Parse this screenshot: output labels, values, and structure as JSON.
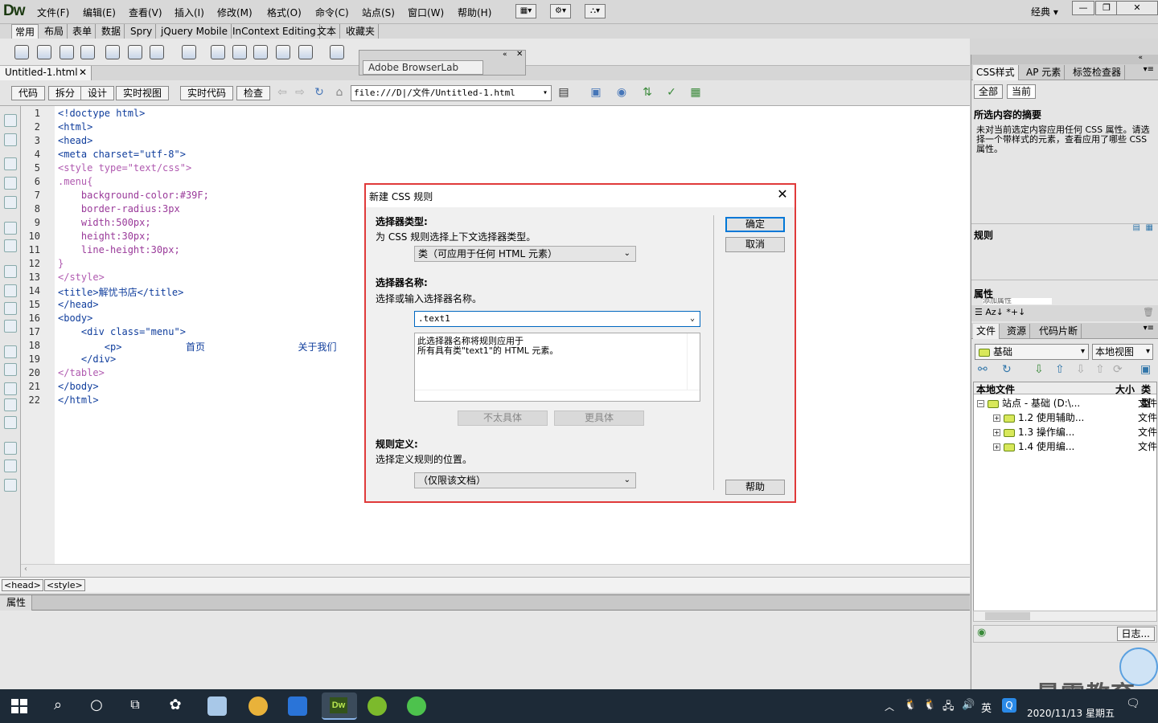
{
  "app": {
    "logo": "Dw",
    "workspace": "经典"
  },
  "menus": [
    "文件(F)",
    "编辑(E)",
    "查看(V)",
    "插入(I)",
    "修改(M)",
    "格式(O)",
    "命令(C)",
    "站点(S)",
    "窗口(W)",
    "帮助(H)"
  ],
  "insert_tabs": [
    "常用",
    "布局",
    "表单",
    "数据",
    "Spry",
    "jQuery Mobile",
    "InContext Editing",
    "文本",
    "收藏夹"
  ],
  "browserlab": {
    "title": "Adobe BrowserLab"
  },
  "document": {
    "tab": "Untitled-1.html",
    "views": [
      "代码",
      "拆分",
      "设计",
      "实时视图",
      "实时代码",
      "检查"
    ],
    "address": "file:///D|/文件/Untitled-1.html"
  },
  "code_lines": [
    "<!doctype html>",
    "<html>",
    "<head>",
    "<meta charset=\"utf-8\">",
    "<style type=\"text/css\">",
    ".menu{",
    "    background-color:#39F;",
    "    border-radius:3px",
    "    width:500px;",
    "    height:30px;",
    "    line-height:30px;",
    "}",
    "</style>",
    "<title>解忧书店</title>",
    "</head>",
    "<body>",
    "    <div class=\"menu\">",
    "        <p>           首页                关于我们",
    "    </div>",
    "</table>",
    "</body>",
    "</html>"
  ],
  "line_numbers": [
    "1",
    "2",
    "3",
    "4",
    "5",
    "6",
    "7",
    "8",
    "9",
    "10",
    "11",
    "12",
    "13",
    "14",
    "15",
    "16",
    "17",
    "18",
    "19",
    "20",
    "21",
    "22"
  ],
  "tag_selector": [
    "<head>",
    "<style>"
  ],
  "properties_tab": "属性",
  "right_panel": {
    "css_tabs": [
      "CSS样式",
      "AP 元素",
      "标签检查器"
    ],
    "css_mode": [
      "全部",
      "当前"
    ],
    "summary_title": "所选内容的摘要",
    "summary_text": "未对当前选定内容应用任何 CSS 属性。请选择一个带样式的元素，查看应用了哪些 CSS 属性。",
    "rules_title": "规则",
    "props_title": "属性",
    "props_add": "添加属性",
    "files_tabs": [
      "文件",
      "资源",
      "代码片断"
    ],
    "site_select": "基础",
    "view_select": "本地视图",
    "columns": [
      "本地文件",
      "大小",
      "类型"
    ],
    "tree": [
      {
        "label": "站点 - 基础 (D:\\...",
        "type": "文件"
      },
      {
        "label": "1.2 使用辅助...",
        "type": "文件"
      },
      {
        "label": "1.3 操作编...",
        "type": "文件"
      },
      {
        "label": "1.4 使用编...",
        "type": "文件"
      }
    ],
    "log_button": "日志..."
  },
  "dialog": {
    "title": "新建 CSS 规则",
    "selector_type_label": "选择器类型:",
    "selector_type_desc": "为 CSS 规则选择上下文选择器类型。",
    "selector_type_value": "类（可应用于任何 HTML 元素）",
    "selector_name_label": "选择器名称:",
    "selector_name_desc": "选择或输入选择器名称。",
    "selector_name_value": ".text1",
    "info_text": "此选择器名称将规则应用于\n所有具有类\"text1\"的 HTML 元素。",
    "less_specific": "不太具体",
    "more_specific": "更具体",
    "rule_def_label": "规则定义:",
    "rule_def_desc": "选择定义规则的位置。",
    "rule_def_value": "（仅限该文档）",
    "ok": "确定",
    "cancel": "取消",
    "help": "帮助"
  },
  "taskbar": {
    "ime": "英",
    "time": "",
    "date": "2020/11/13 星期五"
  },
  "watermark": "最需教育",
  "colors": {
    "accent": "#0078d7",
    "dialog_border": "#e03a3a",
    "taskbar": "#1d2a37"
  }
}
